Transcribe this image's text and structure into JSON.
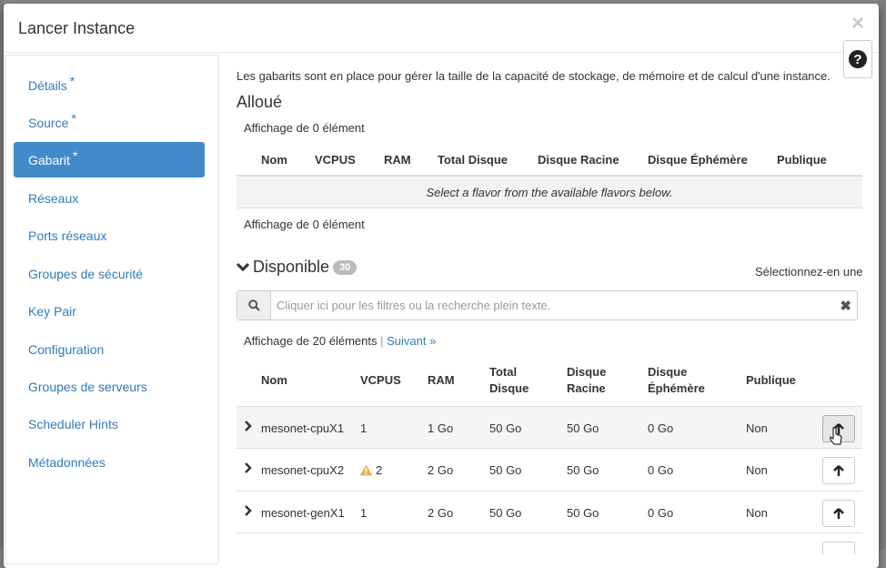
{
  "modal": {
    "title": "Lancer Instance",
    "close_glyph": "×",
    "help_glyph": "?"
  },
  "sidebar": {
    "items": [
      {
        "label": "Détails",
        "required": "*"
      },
      {
        "label": "Source",
        "required": "*"
      },
      {
        "label": "Gabarit",
        "required": "*",
        "active": true
      },
      {
        "label": "Réseaux"
      },
      {
        "label": "Ports réseaux"
      },
      {
        "label": "Groupes de sécurité"
      },
      {
        "label": "Key Pair"
      },
      {
        "label": "Configuration"
      },
      {
        "label": "Groupes de serveurs"
      },
      {
        "label": "Scheduler Hints"
      },
      {
        "label": "Métadonnées"
      }
    ]
  },
  "main": {
    "description": "Les gabarits sont en place pour gérer la taille de la capacité de stockage, de mémoire et de calcul d'une instance.",
    "allocated": {
      "title": "Alloué",
      "count_top": "Affichage de 0 élément",
      "count_bottom": "Affichage de 0 élément",
      "columns": [
        "Nom",
        "VCPUS",
        "RAM",
        "Total Disque",
        "Disque Racine",
        "Disque Éphémère",
        "Publique"
      ],
      "empty_message": "Select a flavor from the available flavors below."
    },
    "available": {
      "title": "Disponible",
      "badge": "30",
      "select_hint": "Sélectionnez-en une",
      "search_placeholder": "Cliquer ici pour les filtres ou la recherche plein texte.",
      "count": "Affichage de 20 éléments",
      "separator": "|",
      "next_link": "Suivant »",
      "columns": {
        "name": "Nom",
        "vcpus": "VCPUS",
        "ram": "RAM",
        "total_disk_1": "Total",
        "total_disk_2": "Disque",
        "root_disk_1": "Disque",
        "root_disk_2": "Racine",
        "eph_disk_1": "Disque",
        "eph_disk_2": "Éphémère",
        "public": "Publique"
      },
      "rows": [
        {
          "name": "mesonet-cpuX1",
          "vcpus": "1",
          "ram": "1 Go",
          "total": "50 Go",
          "root": "50 Go",
          "eph": "0 Go",
          "public": "Non"
        },
        {
          "name": "mesonet-cpuX2",
          "vcpus": "2",
          "ram": "2 Go",
          "total": "50 Go",
          "root": "50 Go",
          "eph": "0 Go",
          "public": "Non",
          "warning": "warning-icon"
        },
        {
          "name": "mesonet-genX1",
          "vcpus": "1",
          "ram": "2 Go",
          "total": "50 Go",
          "root": "50 Go",
          "eph": "0 Go",
          "public": "Non"
        }
      ]
    }
  },
  "colors": {
    "accent": "#428bca",
    "link": "#337ab7",
    "warning": "#f0ad4e",
    "badge": "#bbbbbb"
  }
}
